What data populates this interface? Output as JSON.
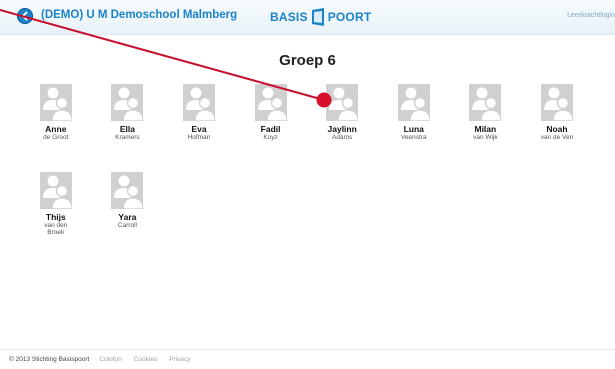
{
  "header": {
    "school_name": "(DEMO) U M Demoschool Malmberg",
    "logo_left": "BASIS",
    "logo_right": "POORT",
    "teacher_link": "Leerkrachtlogin"
  },
  "page": {
    "title": "Groep 6"
  },
  "students": [
    {
      "first": "Anne",
      "last": "de Groot"
    },
    {
      "first": "Ella",
      "last": "Kramers"
    },
    {
      "first": "Eva",
      "last": "Hofman"
    },
    {
      "first": "Fadil",
      "last": "Koyz"
    },
    {
      "first": "Jaylinn",
      "last": "Adams"
    },
    {
      "first": "Luna",
      "last": "Veenstra"
    },
    {
      "first": "Milan",
      "last": "van Wijk"
    },
    {
      "first": "Noah",
      "last": "van de Ven"
    },
    {
      "first": "Thijs",
      "last": "van den Broek"
    },
    {
      "first": "Yara",
      "last": "Carroll"
    }
  ],
  "footer": {
    "copyright": "© 2013 Stichting Basispoort",
    "links": [
      "Colofon",
      "Cookies",
      "Privacy"
    ]
  },
  "colors": {
    "accent": "#1b83c8",
    "annotation": "#c8102e"
  }
}
